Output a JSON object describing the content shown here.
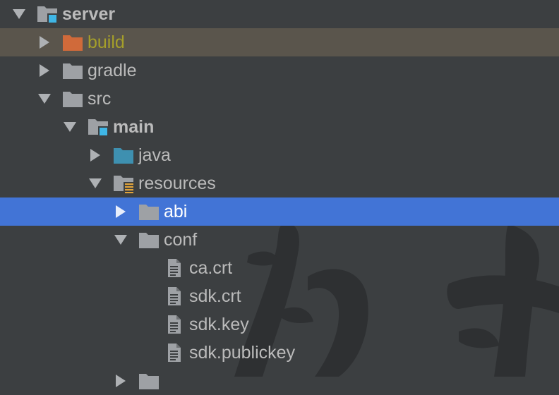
{
  "tree": [
    {
      "label": "server",
      "depth": 0,
      "expanded": true,
      "icon": "module-folder-icon",
      "bold": true
    },
    {
      "label": "build",
      "depth": 1,
      "expanded": false,
      "icon": "excluded-folder-icon",
      "highlighted": true,
      "excluded": true
    },
    {
      "label": "gradle",
      "depth": 1,
      "expanded": false,
      "icon": "folder-icon"
    },
    {
      "label": "src",
      "depth": 1,
      "expanded": true,
      "icon": "folder-icon"
    },
    {
      "label": "main",
      "depth": 2,
      "expanded": true,
      "icon": "module-folder-icon",
      "bold": true
    },
    {
      "label": "java",
      "depth": 3,
      "expanded": false,
      "icon": "source-folder-icon"
    },
    {
      "label": "resources",
      "depth": 3,
      "expanded": true,
      "icon": "resources-folder-icon"
    },
    {
      "label": "abi",
      "depth": 4,
      "expanded": false,
      "icon": "folder-icon",
      "selected": true
    },
    {
      "label": "conf",
      "depth": 4,
      "expanded": true,
      "icon": "folder-icon"
    },
    {
      "label": "ca.crt",
      "depth": 5,
      "icon": "text-file-icon"
    },
    {
      "label": "sdk.crt",
      "depth": 5,
      "icon": "text-file-icon"
    },
    {
      "label": "sdk.key",
      "depth": 5,
      "icon": "text-file-icon"
    },
    {
      "label": "sdk.publickey",
      "depth": 5,
      "icon": "text-file-icon"
    },
    {
      "label": "",
      "depth": 4,
      "expanded": false,
      "icon": "folder-icon"
    }
  ],
  "colors": {
    "background": "#3c3f41",
    "text": "#bbbbbb",
    "selection": "#4274d6",
    "highlight": "#5a554c",
    "excluded_text": "#a59f2a",
    "folder": "#9ea1a5",
    "excluded_folder": "#d06a3a",
    "source_folder": "#3e90b0",
    "module_badge": "#3fb6e6",
    "resources_badge": "#e0a33b",
    "watermark": "#2c2e30"
  }
}
